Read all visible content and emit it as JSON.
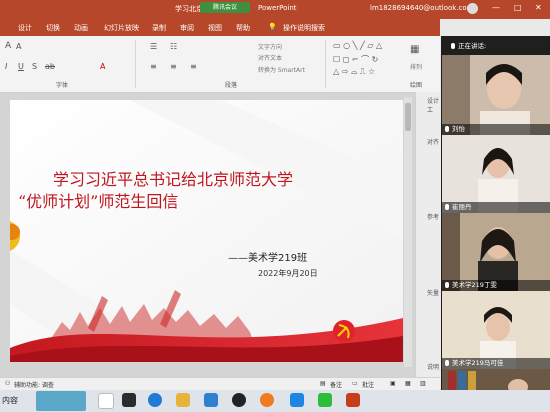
{
  "titlebar": {
    "title": "学习北京",
    "meeting_badge": "腾讯会议",
    "app": "PowerPoint",
    "email": "lm1828694640@outlook.com",
    "avatar_letter": "L",
    "minimize": "—",
    "maximize": "□",
    "close": "✕"
  },
  "tabs": [
    "设计",
    "切换",
    "动画",
    "幻灯片放映",
    "录制",
    "审阅",
    "视图",
    "帮助"
  ],
  "search_label": "操作说明搜索",
  "ribbon": {
    "font_group": "字体",
    "paragraph_group": "段落",
    "drawing_group": "绘图",
    "text_direction": "文字方向",
    "align_text": "对齐文本",
    "smartart": "转换为 SmartArt",
    "arrange": "排列"
  },
  "right_strip": [
    "设计工",
    "对齐",
    "参考",
    "矢量",
    "说明"
  ],
  "slide": {
    "title_line1": "学习习近平总书记给北京师范大学",
    "title_line2": "“优师计划”师范生回信",
    "author": "——美术学219班",
    "date": "2022年9月20日"
  },
  "status": {
    "accessibility": "辅助功能: 调查",
    "notes": "备注",
    "comments": "批注"
  },
  "taskbar_label": "内容",
  "participants": {
    "speaking_label": "正在讲话:",
    "names": [
      "刘怡",
      "崔丽丹",
      "美术学219丁雯",
      "美术学219马可佳",
      ""
    ]
  },
  "colors": {
    "ppt_red": "#b7472a",
    "slide_title_red": "#c0141e"
  }
}
